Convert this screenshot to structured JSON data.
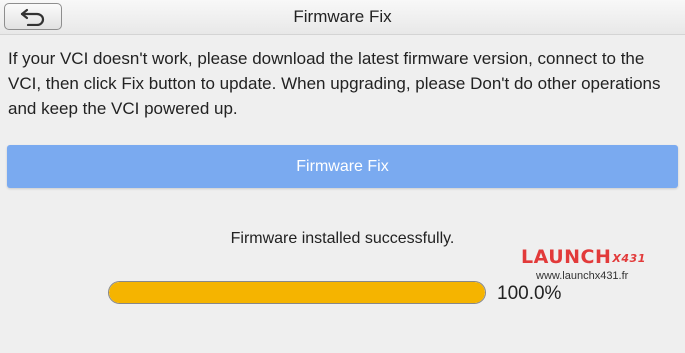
{
  "header": {
    "title": "Firmware Fix",
    "back_icon": "back-arrow-icon"
  },
  "description": "If your VCI doesn't work, please download the latest firmware version, connect to the VCI, then click Fix button to update. When upgrading, please Don't do other operations and keep the VCI powered up.",
  "fix_button_label": "Firmware Fix",
  "status": {
    "message": "Firmware installed successfully.",
    "progress_percent": 100.0,
    "progress_label": "100.0%"
  },
  "watermark": {
    "logo_text": "LAUNCH",
    "logo_suffix": "X431",
    "url": "www.launchx431.fr"
  },
  "colors": {
    "button": "#7aaaf0",
    "progress": "#f5b400",
    "watermark": "#e23a3a"
  }
}
